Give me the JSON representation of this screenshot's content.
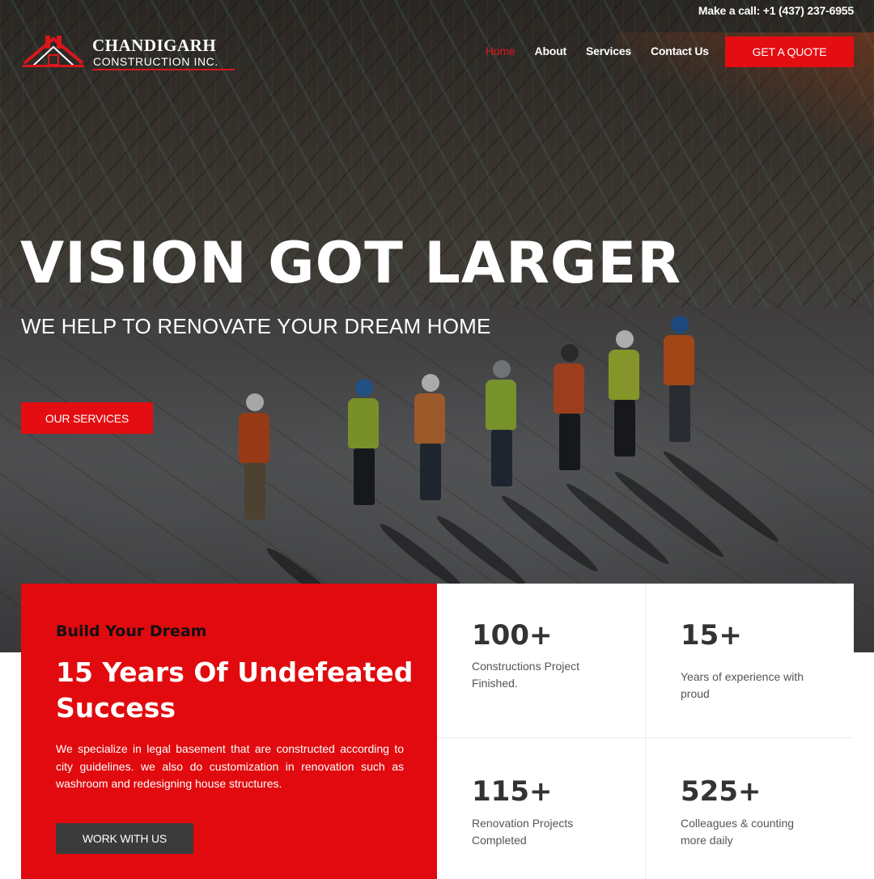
{
  "topbar": {
    "call_text": "Make a call: +1 (437) 237-6955"
  },
  "logo": {
    "name": "CHANDIGARH",
    "sub": "CONSTRUCTION INC."
  },
  "nav": {
    "items": [
      {
        "label": "Home"
      },
      {
        "label": "About"
      },
      {
        "label": "Services"
      },
      {
        "label": "Contact Us"
      }
    ],
    "quote_label": "GET A QUOTE"
  },
  "hero": {
    "title": "VISION GOT LARGER",
    "subtitle": "WE HELP TO RENOVATE YOUR DREAM HOME",
    "button_label": "OUR SERVICES"
  },
  "intro": {
    "kicker": "Build Your Dream",
    "title": "15 Years Of Undefeated Success",
    "text": "We specialize in legal basement that are constructed according to city guidelines. we also do customization in renovation such as washroom and redesigning house structures.",
    "button_label": "WORK WITH US"
  },
  "stats": [
    {
      "number": "100+",
      "label": "Constructions Project Finished."
    },
    {
      "number": "15+",
      "label": "Years of experience with proud"
    },
    {
      "number": "115+",
      "label": "Renovation Projects Completed"
    },
    {
      "number": "525+",
      "label": "Colleagues & counting more daily"
    }
  ],
  "colors": {
    "accent": "#e30d12",
    "dark_button": "#3b3b3b",
    "text_dark": "#333333"
  }
}
